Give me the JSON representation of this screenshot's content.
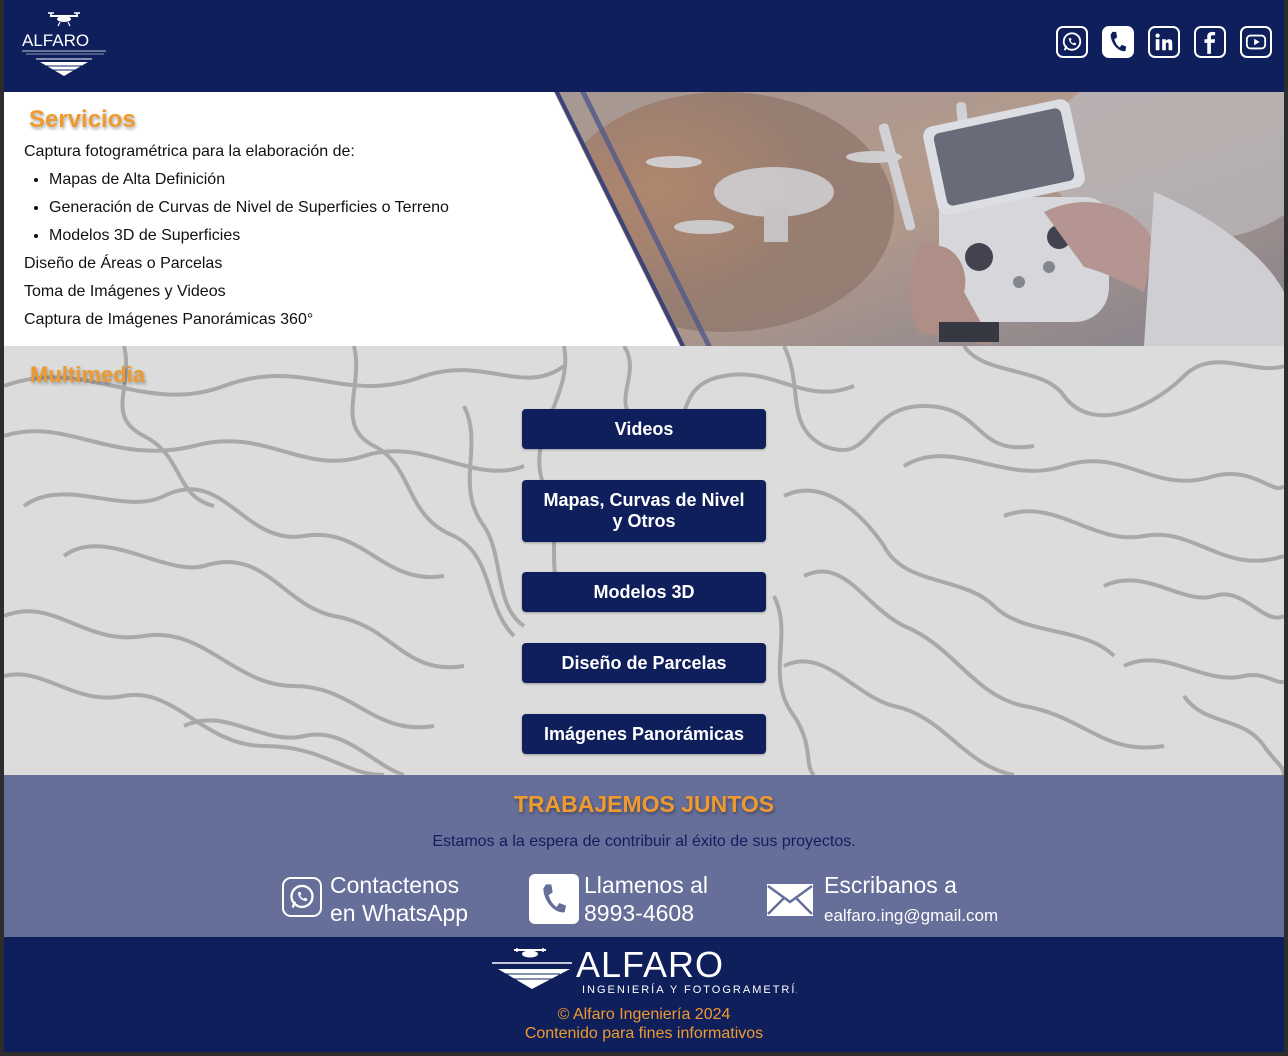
{
  "brand": {
    "logo_text": "ALFARO",
    "logo_tagline": "INGENIERÍA Y FOTOGRAMETRÍA"
  },
  "header": {
    "social": [
      "whatsapp-icon",
      "phone-icon",
      "linkedin-icon",
      "facebook-icon",
      "youtube-icon"
    ]
  },
  "servicios": {
    "title": "Servicios",
    "intro": "Captura fotogramétrica para la elaboración de:",
    "list": [
      "Mapas de Alta Definición",
      "Generación de Curvas de Nivel de Superficies o Terreno",
      "Modelos 3D de Superficies"
    ],
    "extra": [
      "Diseño de Áreas o Parcelas",
      "Toma de Imágenes y Videos",
      "Captura de Imágenes Panorámicas 360°"
    ]
  },
  "multimedia": {
    "title": "Multimedia",
    "buttons": [
      "Videos",
      "Mapas, Curvas de Nivel y Otros",
      "Modelos 3D",
      "Diseño de Parcelas",
      "Imágenes Panorámicas"
    ]
  },
  "contact": {
    "title": "TRABAJEMOS JUNTOS",
    "subtitle": "Estamos a la espera de contribuir al éxito de sus proyectos.",
    "whatsapp_line1": "Contactenos",
    "whatsapp_line2": "en WhatsApp",
    "phone_line1": "Llamenos al",
    "phone_line2": "8993-4608",
    "email_line1": "Escribanos a",
    "email_line2": "ealfaro.ing@gmail.com"
  },
  "footer": {
    "copyright": "© Alfaro Ingeniería 2024",
    "note": "Contenido para fines informativos"
  },
  "colors": {
    "navy": "#0f1f5c",
    "orange": "#ef9a2e",
    "slate": "#666e9a",
    "topo_bg": "#dcdcdc"
  }
}
